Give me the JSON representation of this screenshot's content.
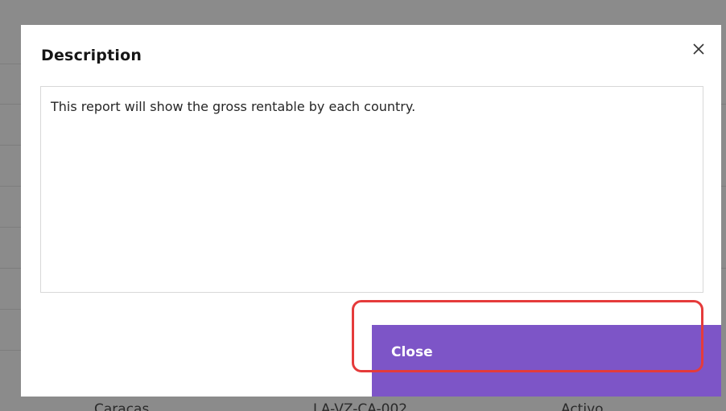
{
  "background": {
    "table_row": {
      "city": "Caracas",
      "code": "LA-VZ-CA-002",
      "status": "Activo"
    }
  },
  "modal": {
    "title": "Description",
    "close_icon": "close-icon",
    "description_text": "This report will show the gross rentable by each country.",
    "close_button_label": "Close"
  },
  "colors": {
    "accent": "#7d55c7",
    "highlight": "#e53b3b",
    "overlay": "#8b8b8b"
  }
}
